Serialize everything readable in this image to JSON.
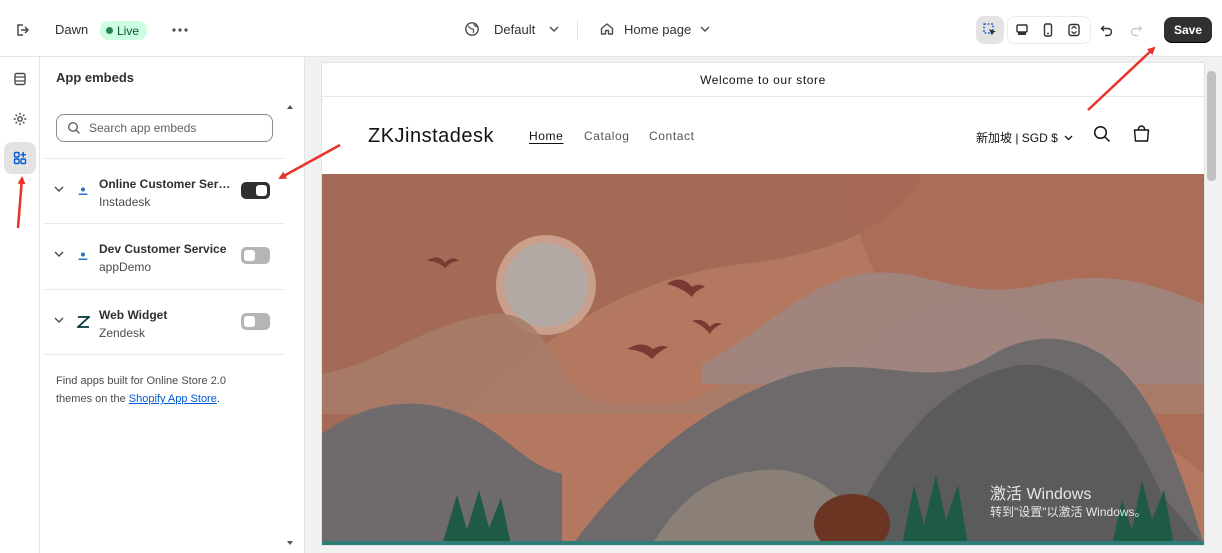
{
  "topbar": {
    "theme_name": "Dawn",
    "status_badge": "Live",
    "theme_selector": "Default",
    "page_selector": "Home page",
    "save_label": "Save"
  },
  "panel": {
    "title": "App embeds",
    "search_placeholder": "Search app embeds",
    "embeds": [
      {
        "name": "Online Customer Service",
        "provider": "Instadesk",
        "enabled": true,
        "icon": "instadesk-icon"
      },
      {
        "name": "Dev Customer Service",
        "provider": "appDemo",
        "enabled": false,
        "icon": "instadesk-icon"
      },
      {
        "name": "Web Widget",
        "provider": "Zendesk",
        "enabled": false,
        "icon": "zendesk-icon"
      }
    ],
    "footnote_prefix": "Find apps built for Online Store 2.0 themes on the ",
    "footnote_link": "Shopify App Store",
    "footnote_suffix": "."
  },
  "preview": {
    "announcement": "Welcome to our store",
    "store_name": "ZKJinstadesk",
    "nav": [
      "Home",
      "Catalog",
      "Contact"
    ],
    "currency": "新加坡 | SGD $"
  },
  "overlay": {
    "windows_title": "激活 Windows",
    "windows_subtitle": "转到\"设置\"以激活 Windows。"
  },
  "colors": {
    "accent": "#303030",
    "live_badge": "#cdfee1",
    "link": "#005bd3",
    "annotation_arrow": "#e8332a"
  }
}
